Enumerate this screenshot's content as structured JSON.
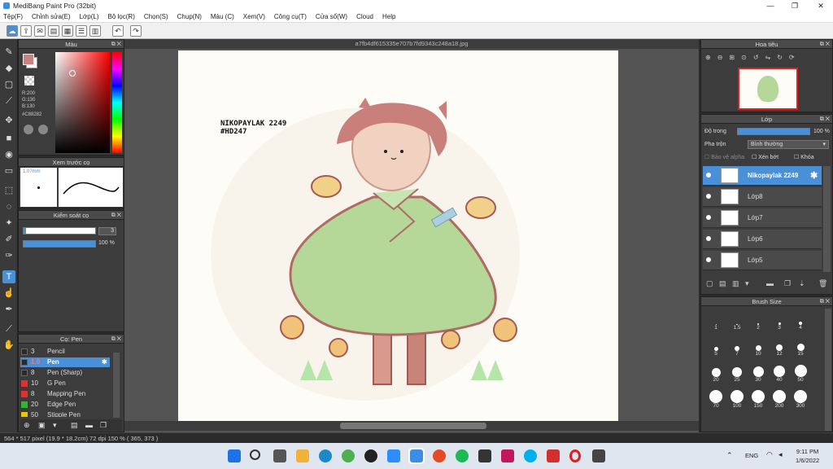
{
  "window": {
    "title": "MediBang Paint Pro (32bit)"
  },
  "menu": [
    "Tệp(F)",
    "Chỉnh sửa(E)",
    "Lớp(L)",
    "Bộ lọc(R)",
    "Chọn(S)",
    "Chụp(N)",
    "Màu (C)",
    "Xem(V)",
    "Công cụ(T)",
    "Cửa sổ(W)",
    "Cloud",
    "Help"
  ],
  "color_panel": {
    "title": "Màu",
    "r": "R:200",
    "g": "G:130",
    "b": "B:130",
    "hex": "#C88282",
    "foreground": "#C88282",
    "background": "#FFFFFF"
  },
  "brush_preview": {
    "title": "Xem trước cọ",
    "size": "1.07mm"
  },
  "brush_control": {
    "title": "Kiểm soát cọ",
    "size_value": "3",
    "opacity_value": "100 %"
  },
  "brush_list": {
    "title": "Cọ: Pen",
    "items": [
      {
        "num": "3",
        "name": "Pencil",
        "color": "#2a2a2a"
      },
      {
        "num": "1.0",
        "name": "Pen",
        "color": "#2a2a2a",
        "selected": true
      },
      {
        "num": "8",
        "name": "Pen (Sharp)",
        "color": "#2a2a2a"
      },
      {
        "num": "10",
        "name": "G Pen",
        "color": "#e03030"
      },
      {
        "num": "8",
        "name": "Mapping Pen",
        "color": "#e03030"
      },
      {
        "num": "20",
        "name": "Edge Pen",
        "color": "#2db82d"
      },
      {
        "num": "50",
        "name": "Stipple Pen",
        "color": "#e8c800"
      }
    ]
  },
  "document": {
    "tab": "a7fb4df615335e707b7fd9343c248a18.jpg"
  },
  "artwork": {
    "text_line1": "NIKOPAYLAK 2249",
    "text_line2": "#HD247"
  },
  "navigator": {
    "title": "Hoa tiêu"
  },
  "layer_panel": {
    "title": "Lớp",
    "opacity_label": "Độ trong",
    "opacity_value": "100 %",
    "blend_label": "Pha trộn",
    "blend_value": "Bình thường",
    "protect_alpha": "Bảo vệ alpha",
    "clipping": "Xén bớt",
    "lock": "Khóa",
    "layers": [
      {
        "name": "Nikopaylak 2249",
        "selected": true
      },
      {
        "name": "Lớp8"
      },
      {
        "name": "Lớp7"
      },
      {
        "name": "Lớp6"
      },
      {
        "name": "Lớp5"
      }
    ]
  },
  "brush_size": {
    "title": "Brush Size",
    "sizes": [
      "1",
      "1.5",
      "2",
      "3",
      "4",
      "5",
      "7",
      "10",
      "12",
      "15",
      "20",
      "25",
      "30",
      "40",
      "50",
      "70",
      "100",
      "150",
      "200",
      "300"
    ]
  },
  "status": {
    "text": "564 * 517 pixel   (19.9 * 18.2cm)  72 dpi  150 %  ( 365, 373 )"
  },
  "taskbar": {
    "lang": "ENG",
    "time": "9:11 PM",
    "date": "1/6/2022"
  }
}
